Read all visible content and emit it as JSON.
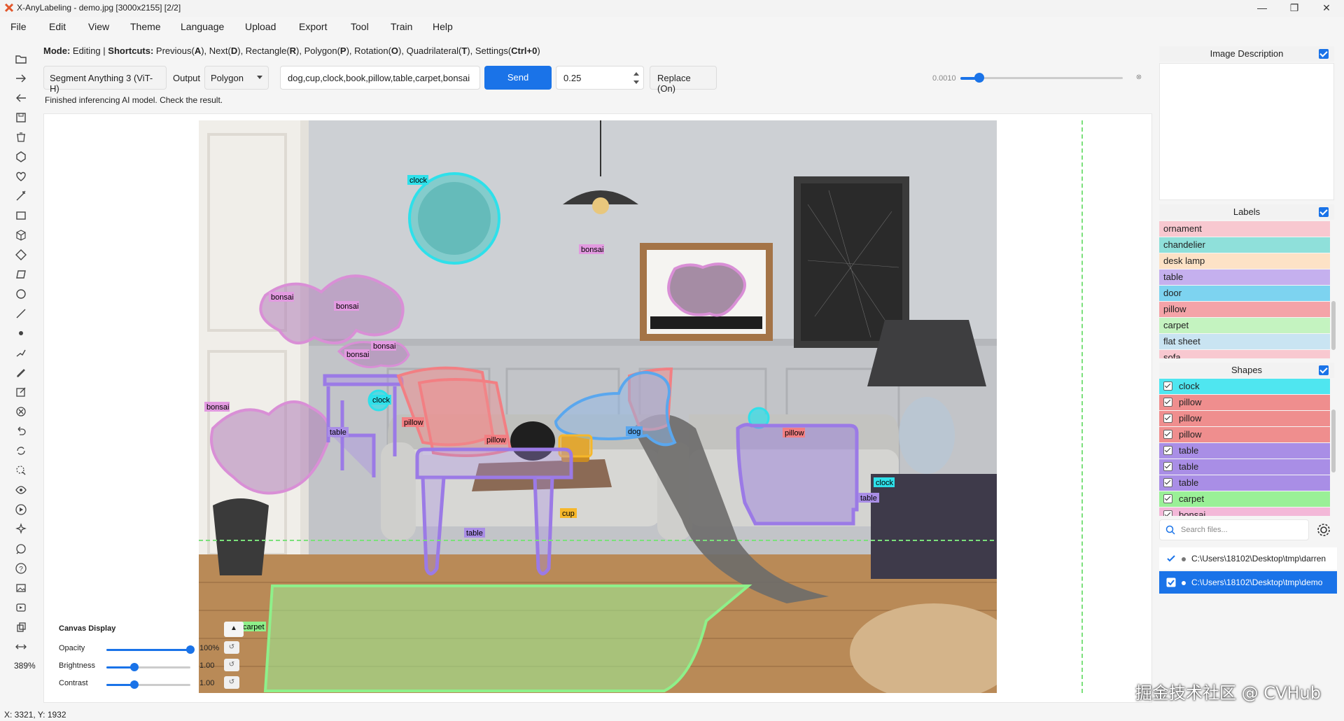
{
  "window": {
    "title": "X-AnyLabeling - demo.jpg [3000x2155] [2/2]",
    "minimize": "—",
    "maximize": "❐",
    "close": "✕"
  },
  "menu": [
    "File",
    "Edit",
    "View",
    "Theme",
    "Language",
    "Upload",
    "Export",
    "Tool",
    "Train",
    "Help"
  ],
  "modeline": {
    "mode_label": "Mode:",
    "mode_value": "Editing |",
    "shortcuts_label": "Shortcuts:",
    "items": [
      "Previous(",
      "A",
      "), Next(",
      "D",
      "), Rectangle(",
      "R",
      "), Polygon(",
      "P",
      "), Rotation(",
      "O",
      "), Quadrilateral(",
      "T",
      "), Settings(",
      "Ctrl+0",
      ")"
    ]
  },
  "ai_bar": {
    "model": "Segment Anything 3 (ViT-H)",
    "output_label": "Output",
    "output_value": "Polygon",
    "prompt": "dog,cup,clock,book,pillow,table,carpet,bonsai",
    "send": "Send",
    "confidence": "0.25",
    "replace": "Replace (On)",
    "status": "Finished inferencing AI model. Check the result.",
    "slider_value": "0.0010",
    "slider_level": 0.1
  },
  "toolbar": {
    "zoom": "389%",
    "icons": [
      "open-folder-icon",
      "next-image-icon",
      "prev-image-icon",
      "save-icon",
      "delete-icon",
      "polygon-icon",
      "heart-shape-icon",
      "ai-wand-icon",
      "rectangle-icon",
      "cube-icon",
      "rotation-icon",
      "quadrilateral-icon",
      "circle-icon",
      "line-icon",
      "point-icon",
      "linestrip-icon",
      "edit-pen-icon",
      "edit-box-icon",
      "cancel-icon",
      "undo-icon",
      "loop-icon",
      "magic-select-icon",
      "visibility-icon",
      "play-icon",
      "sparkle-icon",
      "chat-icon",
      "help-icon",
      "image-icon",
      "video-icon",
      "copy-icon",
      "fit-width-icon"
    ]
  },
  "canvas_display": {
    "title": "Canvas Display",
    "rows": [
      {
        "label": "Opacity",
        "value": "100%",
        "level": 1.0
      },
      {
        "label": "Brightness",
        "value": "1.00",
        "level": 0.33
      },
      {
        "label": "Contrast",
        "value": "1.00",
        "level": 0.33
      }
    ]
  },
  "annotations": [
    "clock",
    "bonsai",
    "bonsai",
    "bonsai",
    "bonsai",
    "bonsai",
    "bonsai",
    "table",
    "clock",
    "pillow",
    "pillow",
    "dog",
    "pillow",
    "cup",
    "table",
    "clock",
    "table",
    "carpet"
  ],
  "right_panel": {
    "image_description": "Image Description",
    "labels_title": "Labels",
    "labels": [
      {
        "name": "ornament",
        "color": "#f8c8d0"
      },
      {
        "name": "chandelier",
        "color": "#8fe0da"
      },
      {
        "name": "desk lamp",
        "color": "#fde2c6"
      },
      {
        "name": "table",
        "color": "#c5b0ee"
      },
      {
        "name": "door",
        "color": "#7dd3f0"
      },
      {
        "name": "pillow",
        "color": "#f4a3a8"
      },
      {
        "name": "carpet",
        "color": "#c4f3c0"
      },
      {
        "name": "flat sheet",
        "color": "#c9e4f2"
      },
      {
        "name": "sofa",
        "color": "#f8c8d0"
      }
    ],
    "shapes_title": "Shapes",
    "shapes": [
      {
        "name": "clock",
        "color": "#4fe6f0"
      },
      {
        "name": "pillow",
        "color": "#ef8e8e"
      },
      {
        "name": "pillow",
        "color": "#ef8e8e"
      },
      {
        "name": "pillow",
        "color": "#ef8e8e"
      },
      {
        "name": "table",
        "color": "#a98ee6"
      },
      {
        "name": "table",
        "color": "#a98ee6"
      },
      {
        "name": "table",
        "color": "#a98ee6"
      },
      {
        "name": "carpet",
        "color": "#9af097"
      },
      {
        "name": "bonsai",
        "color": "#f3b8d8"
      }
    ],
    "search_placeholder": "Search files...",
    "files": [
      {
        "path": "C:\\Users\\18102\\Desktop\\tmp\\darren",
        "selected": false
      },
      {
        "path": "C:\\Users\\18102\\Desktop\\tmp\\demo",
        "selected": true
      }
    ]
  },
  "status": {
    "coords": "X: 3321, Y: 1932"
  },
  "watermark": "掘金技术社区 @ CVHub"
}
